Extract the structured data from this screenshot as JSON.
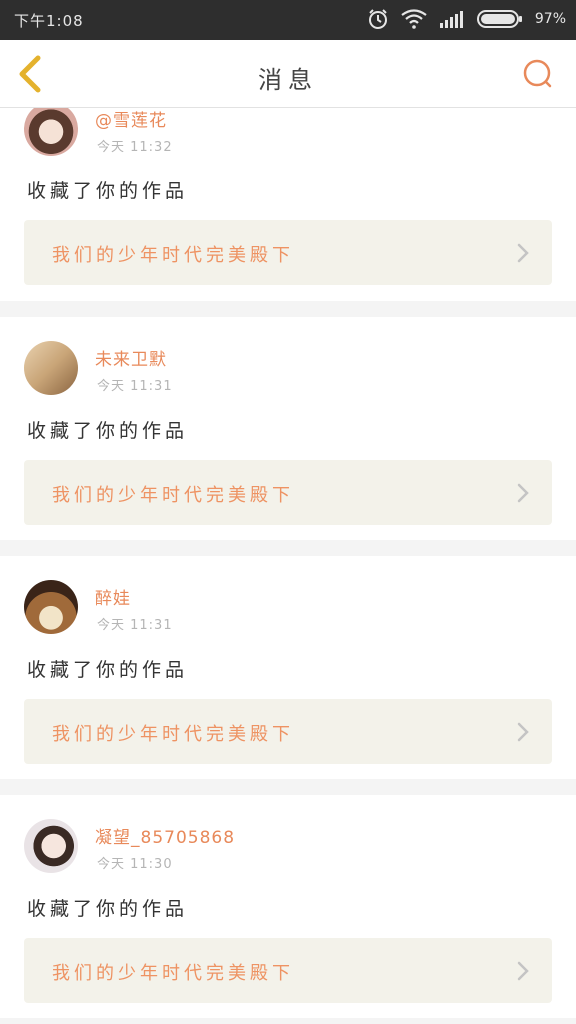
{
  "status_bar": {
    "time": "下午1:08",
    "battery": "97%",
    "icons": [
      "alarm-icon",
      "wifi-icon",
      "signal-icon",
      "battery-icon"
    ]
  },
  "header": {
    "title": "消息",
    "back_icon": "back-chevron-icon",
    "search_icon": "search-icon"
  },
  "colors": {
    "accent": "#e8895a",
    "back": "#e4b22d",
    "card_bg": "#f3f2ea"
  },
  "messages": [
    {
      "user": "@雪莲花",
      "time": "今天 11:32",
      "action": "收藏了你的作品",
      "work_title": "我们的少年时代完美殿下"
    },
    {
      "user": "未来卫默",
      "time": "今天 11:31",
      "action": "收藏了你的作品",
      "work_title": "我们的少年时代完美殿下"
    },
    {
      "user": "醉娃",
      "time": "今天 11:31",
      "action": "收藏了你的作品",
      "work_title": "我们的少年时代完美殿下"
    },
    {
      "user": "凝望_85705868",
      "time": "今天 11:30",
      "action": "收藏了你的作品",
      "work_title": "我们的少年时代完美殿下"
    }
  ]
}
